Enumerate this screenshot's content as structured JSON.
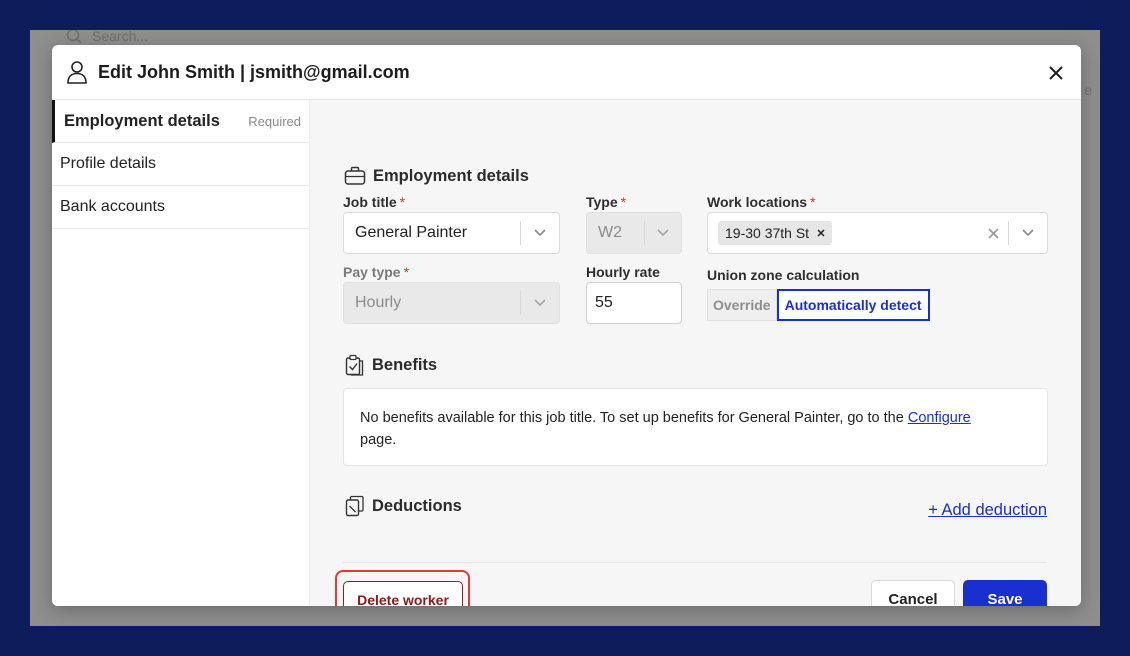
{
  "colors": {
    "accent": "#1a2fd0",
    "danger": "#8b1a1a",
    "highlight": "#e53935",
    "frame": "#0e1c5c"
  },
  "background": {
    "search_placeholder": "Search...",
    "right_text": "e"
  },
  "modal": {
    "title": "Edit John Smith | jsmith@gmail.com",
    "icon": "user-icon",
    "close_icon": "close-icon"
  },
  "sidebar": {
    "items": [
      {
        "label": "Employment details",
        "badge": "Required",
        "active": true
      },
      {
        "label": "Profile details"
      },
      {
        "label": "Bank accounts"
      }
    ]
  },
  "employment": {
    "title": "Employment details",
    "icon": "briefcase-icon",
    "job_title": {
      "label": "Job title",
      "required": "*",
      "value": "General Painter"
    },
    "type": {
      "label": "Type",
      "required": "*",
      "value": "W2",
      "disabled": true
    },
    "work_locations": {
      "label": "Work locations",
      "required": "*",
      "chips": [
        "19-30 37th St"
      ]
    },
    "pay_type": {
      "label": "Pay type",
      "required": "*",
      "value": "Hourly",
      "disabled": true
    },
    "hourly_rate": {
      "label": "Hourly rate",
      "value": "55"
    },
    "union_zone": {
      "label": "Union zone calculation",
      "options": [
        "Override",
        "Automatically detect"
      ],
      "selected": "Automatically detect"
    }
  },
  "benefits": {
    "title": "Benefits",
    "icon": "clipboard-check-icon",
    "message": "No benefits available for this job title. To set up benefits for General Painter, go to the",
    "link": "Configure",
    "suffix": "page."
  },
  "deductions": {
    "title": "Deductions",
    "icon": "clipboard-copy-icon",
    "add_label": "+ Add deduction"
  },
  "footer": {
    "delete_label": "Delete worker",
    "cancel_label": "Cancel",
    "save_label": "Save"
  }
}
